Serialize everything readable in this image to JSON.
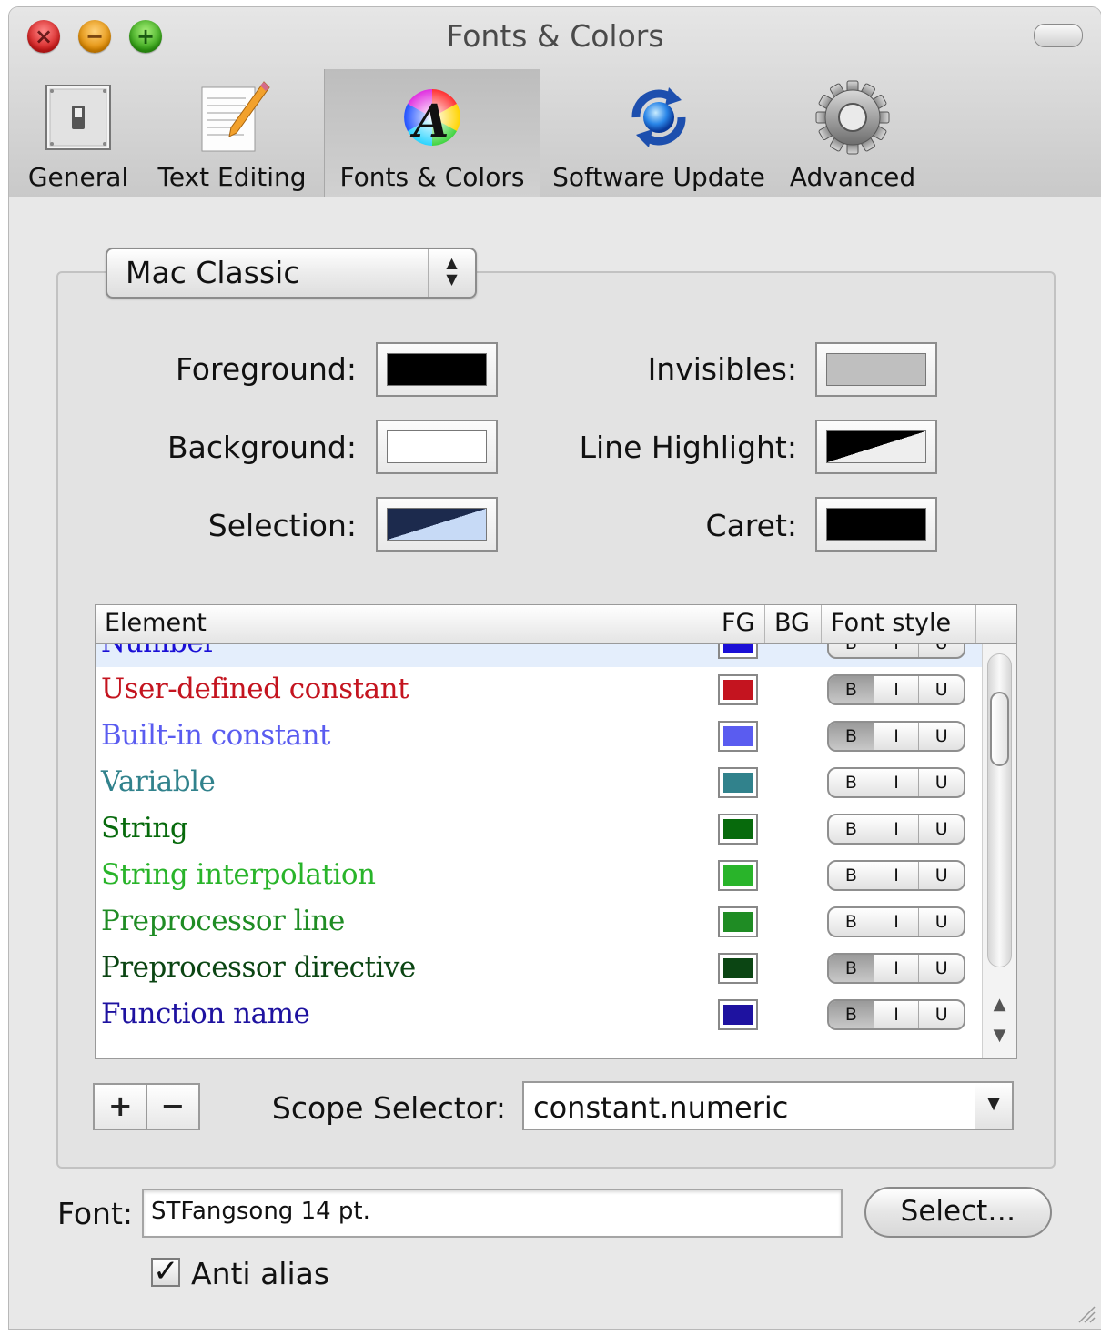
{
  "window": {
    "title": "Fonts & Colors"
  },
  "toolbar": [
    {
      "label": "General",
      "icon": "switch-icon",
      "selected": false
    },
    {
      "label": "Text Editing",
      "icon": "notepad-pencil-icon",
      "selected": false
    },
    {
      "label": "Fonts & Colors",
      "icon": "color-wheel-a-icon",
      "selected": true
    },
    {
      "label": "Software Update",
      "icon": "sync-globe-icon",
      "selected": false
    },
    {
      "label": "Advanced",
      "icon": "gear-icon",
      "selected": false
    }
  ],
  "theme": {
    "selected": "Mac Classic"
  },
  "colors": {
    "foreground": {
      "label": "Foreground:",
      "value": "#000000"
    },
    "background": {
      "label": "Background:",
      "value": "#ffffff"
    },
    "selection": {
      "label": "Selection:",
      "value": [
        "#1c2a4d",
        "#c7daf6"
      ]
    },
    "invisibles": {
      "label": "Invisibles:",
      "value": "#bfbfbf"
    },
    "line_highlight": {
      "label": "Line Highlight:",
      "value": [
        "#000000",
        "#eeeeee"
      ]
    },
    "caret": {
      "label": "Caret:",
      "value": "#000000"
    }
  },
  "table": {
    "columns": [
      "Element",
      "FG",
      "BG",
      "Font style"
    ],
    "rows": [
      {
        "name": "Number",
        "color": "#1a0fd6",
        "fg": "#1a0fd6",
        "style_on": []
      },
      {
        "name": "User-defined constant",
        "color": "#c4141f",
        "fg": "#c4141f",
        "style_on": [
          "B"
        ]
      },
      {
        "name": "Built-in constant",
        "color": "#5a5cf0",
        "fg": "#5a5cf0",
        "style_on": [
          "B"
        ]
      },
      {
        "name": "Variable",
        "color": "#31828c",
        "fg": "#31828c",
        "style_on": []
      },
      {
        "name": "String",
        "color": "#076a0c",
        "fg": "#076a0c",
        "style_on": []
      },
      {
        "name": "String interpolation",
        "color": "#29b42a",
        "fg": "#29b42a",
        "style_on": []
      },
      {
        "name": "Preprocessor line",
        "color": "#1f8c24",
        "fg": "#1f8c24",
        "style_on": []
      },
      {
        "name": "Preprocessor directive",
        "color": "#0b4513",
        "fg": "#0b4513",
        "style_on": [
          "B"
        ]
      },
      {
        "name": "Function name",
        "color": "#1e12a0",
        "fg": "#1e12a0",
        "style_on": [
          "B"
        ]
      }
    ]
  },
  "controls": {
    "add_label": "+",
    "remove_label": "−",
    "scope_label": "Scope Selector:",
    "scope_value": "constant.numeric",
    "font_label": "Font:",
    "font_value": "STFangsong 14 pt.",
    "select_label": "Select…",
    "anti_alias_label": "Anti alias",
    "anti_alias_checked": true
  }
}
